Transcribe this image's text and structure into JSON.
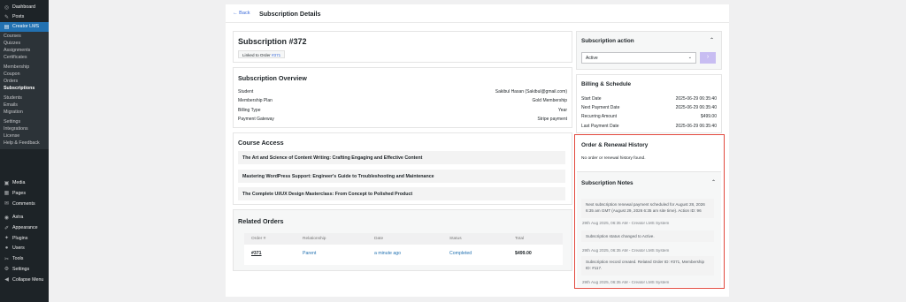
{
  "sidebar": {
    "top_items": [
      {
        "icon": "dashboard-icon",
        "glyph": "◎",
        "label": "Dashboard"
      },
      {
        "icon": "posts-icon",
        "glyph": "✎",
        "label": "Posts"
      },
      {
        "icon": "creator-lms-icon",
        "glyph": "▤",
        "label": "Creator LMS",
        "active": true
      }
    ],
    "sub_items": [
      {
        "label": "Courses"
      },
      {
        "label": "Quizzes"
      },
      {
        "label": "Assignments"
      },
      {
        "label": "Certificates"
      },
      {
        "gap": true
      },
      {
        "label": "Membership"
      },
      {
        "label": "Coupon"
      },
      {
        "label": "Orders"
      },
      {
        "label": "Subscriptions",
        "current": true
      },
      {
        "gap": true
      },
      {
        "label": "Students"
      },
      {
        "label": "Emails"
      },
      {
        "label": "Migration"
      },
      {
        "gap": true
      },
      {
        "label": "Settings"
      },
      {
        "label": "Integrations"
      },
      {
        "label": "License"
      },
      {
        "label": "Help & Feedback"
      }
    ],
    "bottom_items": [
      {
        "icon": "media-icon",
        "glyph": "▣",
        "label": "Media"
      },
      {
        "icon": "pages-icon",
        "glyph": "▦",
        "label": "Pages"
      },
      {
        "icon": "comments-icon",
        "glyph": "✉",
        "label": "Comments"
      },
      {
        "gap": true
      },
      {
        "icon": "astra-icon",
        "glyph": "◉",
        "label": "Astra"
      },
      {
        "icon": "appearance-icon",
        "glyph": "✐",
        "label": "Appearance"
      },
      {
        "icon": "plugins-icon",
        "glyph": "✦",
        "label": "Plugins"
      },
      {
        "icon": "users-icon",
        "glyph": "●",
        "label": "Users"
      },
      {
        "icon": "tools-icon",
        "glyph": "✂",
        "label": "Tools"
      },
      {
        "icon": "settings-icon",
        "glyph": "⚙",
        "label": "Settings"
      },
      {
        "icon": "collapse-icon",
        "glyph": "◀",
        "label": "Collapse Menu"
      }
    ]
  },
  "header": {
    "back": "← Back",
    "title": "Subscription Details"
  },
  "subscription": {
    "title": "Subscription #372",
    "linked_prefix": "Linked to Order",
    "linked_order": "#371"
  },
  "overview": {
    "title": "Subscription Overview",
    "rows": [
      {
        "k": "Student",
        "v": "Sakibul Hasan (Sakibul@gmail.com)"
      },
      {
        "k": "Membership Plan",
        "v": "Gold Membership"
      },
      {
        "k": "Billing Type",
        "v": "Year"
      },
      {
        "k": "Payment Gateway",
        "v": "Stripe payment"
      }
    ]
  },
  "course_access": {
    "title": "Course Access",
    "courses": [
      "The Art and Science of Content Writing: Crafting Engaging and Effective Content",
      "Mastering WordPress Support: Engineer's Guide to Troubleshooting and Maintenance",
      "The Complete UI/UX Design Masterclass: From Concept to Polished Product"
    ]
  },
  "related_orders": {
    "title": "Related Orders",
    "headers": [
      "Order #",
      "Relationship",
      "Date",
      "Status",
      "Total"
    ],
    "row": [
      "#371",
      "Parent",
      "a minute ago",
      "Completed",
      "$499.00"
    ]
  },
  "action": {
    "title": "Subscription action",
    "selected": "Active",
    "go": "›"
  },
  "billing": {
    "title": "Billing & Schedule",
    "rows": [
      {
        "k": "Start Date",
        "v": "2025-06-29 06:35:40"
      },
      {
        "k": "Next Payment Date",
        "v": "2025-06-29 06:35:40"
      },
      {
        "k": "Recurring Amount",
        "v": "$499.00"
      },
      {
        "k": "Last Payment Date",
        "v": "2025-06-29 06:35:40"
      }
    ]
  },
  "history": {
    "title": "Order & Renewal History",
    "empty": "No order or renewal history found."
  },
  "notes": {
    "title": "Subscription Notes",
    "items": [
      {
        "text": "Next subscription renewal payment scheduled for August 28, 2026 6:35 am GMT (August 29, 2026 6:35 am site time). Action ID: 96",
        "meta": "29th Aug 2025, 06:35 AM - Creator LMS System"
      },
      {
        "text": "Subscription status changed to Active.",
        "meta": "29th Aug 2025, 06:35 AM - Creator LMS System"
      },
      {
        "text": "Subscription record created. Related Order ID: #371, Membership ID: #117.",
        "meta": "29th Aug 2025, 06:35 AM - Creator LMS System"
      }
    ]
  },
  "colors": {
    "accent": "#2271b1",
    "highlight": "#e2483d",
    "link": "#3c6bd9"
  }
}
